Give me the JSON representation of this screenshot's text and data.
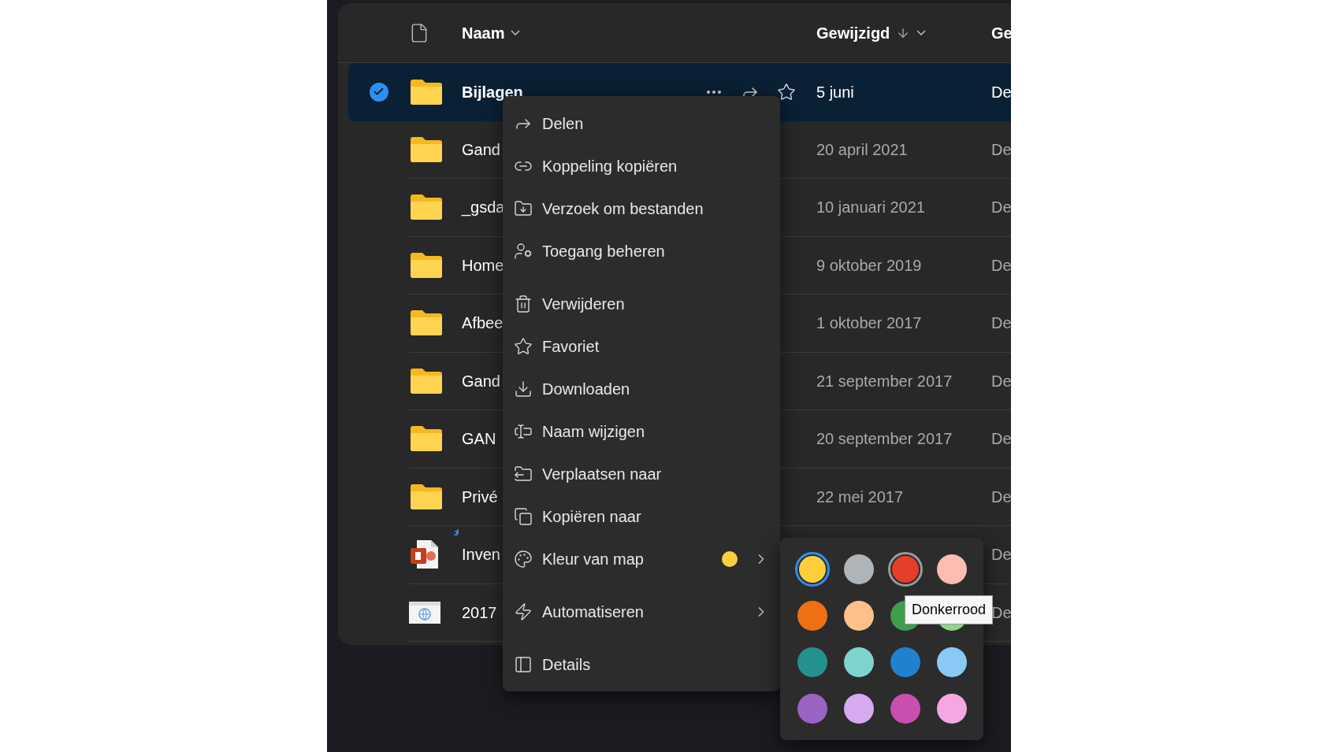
{
  "header": {
    "columns": [
      {
        "label": "Naam",
        "sorted": false
      },
      {
        "label": "Gewijzigd",
        "sorted": true
      },
      {
        "label": "Ge",
        "sorted": false
      }
    ]
  },
  "rows": [
    {
      "kind": "folder",
      "name": "Bijlagen",
      "modified": "5 juni",
      "column_3": "De",
      "selected": true,
      "new": false
    },
    {
      "kind": "folder",
      "name": "Gand",
      "modified": "20 april 2021",
      "column_3": "De",
      "selected": false,
      "new": false
    },
    {
      "kind": "folder",
      "name": "_gsda",
      "modified": "10 januari 2021",
      "column_3": "De",
      "selected": false,
      "new": false
    },
    {
      "kind": "folder",
      "name": "Home",
      "modified": "9 oktober 2019",
      "column_3": "De",
      "selected": false,
      "new": false
    },
    {
      "kind": "folder",
      "name": "Afbee",
      "modified": "1 oktober 2017",
      "column_3": "De",
      "selected": false,
      "new": false
    },
    {
      "kind": "folder",
      "name": "Gand",
      "modified": "21 september 2017",
      "column_3": "De",
      "selected": false,
      "new": false
    },
    {
      "kind": "folder",
      "name": "GAN",
      "modified": "20 september 2017",
      "column_3": "De",
      "selected": false,
      "new": false
    },
    {
      "kind": "folder",
      "name": "Privé",
      "modified": "22 mei 2017",
      "column_3": "De",
      "selected": false,
      "new": false
    },
    {
      "kind": "powerpoint",
      "name": "Inven",
      "column_3": "De",
      "selected": false,
      "new": true
    },
    {
      "kind": "web",
      "name": "2017",
      "column_3": "De",
      "selected": false,
      "new": false
    }
  ],
  "menu": {
    "groups": [
      [
        {
          "label": "Delen",
          "submenu": false
        },
        {
          "label": "Koppeling kopiëren",
          "submenu": false
        },
        {
          "label": "Verzoek om bestanden",
          "submenu": false
        },
        {
          "label": "Toegang beheren",
          "submenu": false
        }
      ],
      [
        {
          "label": "Verwijderen",
          "submenu": false
        },
        {
          "label": "Favoriet",
          "submenu": false
        },
        {
          "label": "Downloaden",
          "submenu": false
        },
        {
          "label": "Naam wijzigen",
          "submenu": false
        },
        {
          "label": "Verplaatsen naar",
          "submenu": false
        },
        {
          "label": "Kopiëren naar",
          "submenu": false
        },
        {
          "label": "Kleur van map",
          "submenu": true,
          "color": "#fdd03b"
        }
      ],
      [
        {
          "label": "Automatiseren",
          "submenu": true
        }
      ],
      [
        {
          "label": "Details",
          "submenu": false
        }
      ]
    ]
  },
  "color_picker": {
    "swatches": [
      {
        "color": "#fdd03b",
        "selected": true,
        "hovered": false
      },
      {
        "color": "#aeb4b7",
        "selected": false,
        "hovered": false
      },
      {
        "color": "#e53f2a",
        "selected": false,
        "hovered": true
      },
      {
        "color": "#ffbcb3",
        "selected": false,
        "hovered": false
      },
      {
        "color": "#ee7012",
        "selected": false,
        "hovered": false
      },
      {
        "color": "#ffc08a",
        "selected": false,
        "hovered": false
      },
      {
        "color": "#3f9d4b",
        "selected": false,
        "hovered": false
      },
      {
        "color": "#8fd48c",
        "selected": false,
        "hovered": false
      },
      {
        "color": "#25918d",
        "selected": false,
        "hovered": false
      },
      {
        "color": "#7fd3ce",
        "selected": false,
        "hovered": false
      },
      {
        "color": "#1f82d0",
        "selected": false,
        "hovered": false
      },
      {
        "color": "#8ac8f6",
        "selected": false,
        "hovered": false
      },
      {
        "color": "#9b63c4",
        "selected": false,
        "hovered": false
      },
      {
        "color": "#d6aaef",
        "selected": false,
        "hovered": false
      },
      {
        "color": "#c84fb0",
        "selected": false,
        "hovered": false
      },
      {
        "color": "#f5a7e1",
        "selected": false,
        "hovered": false
      }
    ],
    "tooltip": "Donkerrood"
  }
}
